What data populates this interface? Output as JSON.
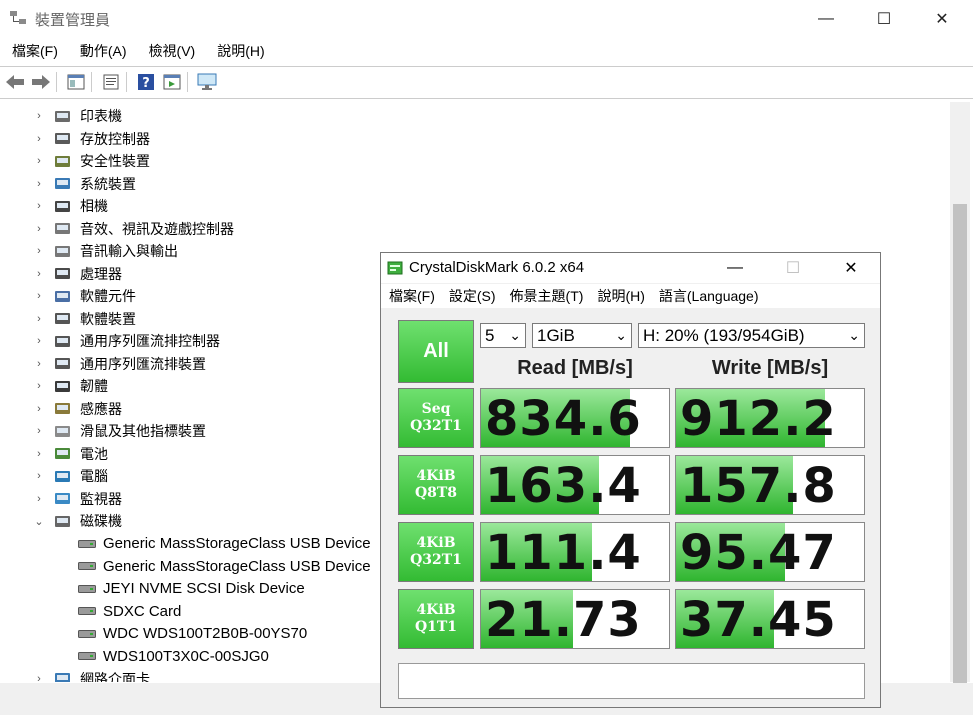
{
  "devmgr": {
    "title": "裝置管理員",
    "window_controls": {
      "minimize": "—",
      "maximize": "☐",
      "close": "✕"
    },
    "menu": [
      "檔案(F)",
      "動作(A)",
      "檢視(V)",
      "說明(H)"
    ],
    "toolbar_icons": [
      "back-arrow-icon",
      "forward-arrow-icon",
      "properties-icon",
      "update-driver-icon",
      "help-icon",
      "view-icon",
      "monitor-icon"
    ],
    "categories": [
      {
        "label": "印表機",
        "icon": "printer-icon",
        "expanded": false
      },
      {
        "label": "存放控制器",
        "icon": "storage-controller-icon",
        "expanded": false
      },
      {
        "label": "安全性裝置",
        "icon": "security-device-icon",
        "expanded": false
      },
      {
        "label": "系統裝置",
        "icon": "system-device-icon",
        "expanded": false
      },
      {
        "label": "相機",
        "icon": "camera-icon",
        "expanded": false
      },
      {
        "label": "音效、視訊及遊戲控制器",
        "icon": "speaker-icon",
        "expanded": false
      },
      {
        "label": "音訊輸入與輸出",
        "icon": "audio-io-icon",
        "expanded": false
      },
      {
        "label": "處理器",
        "icon": "processor-icon",
        "expanded": false
      },
      {
        "label": "軟體元件",
        "icon": "software-component-icon",
        "expanded": false
      },
      {
        "label": "軟體裝置",
        "icon": "software-device-icon",
        "expanded": false
      },
      {
        "label": "通用序列匯流排控制器",
        "icon": "usb-controller-icon",
        "expanded": false
      },
      {
        "label": "通用序列匯流排裝置",
        "icon": "usb-device-icon",
        "expanded": false
      },
      {
        "label": "韌體",
        "icon": "firmware-icon",
        "expanded": false
      },
      {
        "label": "感應器",
        "icon": "sensor-icon",
        "expanded": false
      },
      {
        "label": "滑鼠及其他指標裝置",
        "icon": "mouse-icon",
        "expanded": false
      },
      {
        "label": "電池",
        "icon": "battery-icon",
        "expanded": false
      },
      {
        "label": "電腦",
        "icon": "computer-icon",
        "expanded": false
      },
      {
        "label": "監視器",
        "icon": "monitor-icon",
        "expanded": false
      },
      {
        "label": "磁碟機",
        "icon": "disk-drive-icon",
        "expanded": true
      }
    ],
    "disk_drives": [
      "Generic MassStorageClass USB Device",
      "Generic MassStorageClass USB Device",
      "JEYI NVME SCSI Disk Device",
      "SDXC Card",
      "WDC  WDS100T2B0B-00YS70",
      "WDS100T3X0C-00SJG0"
    ],
    "last_category": {
      "label": "網路介面卡",
      "icon": "network-adapter-icon"
    }
  },
  "cdm": {
    "title": "CrystalDiskMark 6.0.2 x64",
    "window_controls": {
      "minimize": "—",
      "maximize": "☐",
      "close": "✕"
    },
    "menu": [
      "檔案(F)",
      "設定(S)",
      "佈景主題(T)",
      "說明(H)",
      "語言(Language)"
    ],
    "all_label": "All",
    "count_select": "5",
    "size_select": "1GiB",
    "drive_select": "H: 20% (193/954GiB)",
    "read_header": "Read [MB/s]",
    "write_header": "Write [MB/s]",
    "accent": "#33bb33",
    "tests": [
      {
        "line1": "Seq",
        "line2": "Q32T1",
        "read": "834.6",
        "write": "912.2",
        "read_fill": 0.79,
        "write_fill": 0.79
      },
      {
        "line1": "4KiB",
        "line2": "Q8T8",
        "read": "163.4",
        "write": "157.8",
        "read_fill": 0.63,
        "write_fill": 0.62
      },
      {
        "line1": "4KiB",
        "line2": "Q32T1",
        "read": "111.4",
        "write": "95.47",
        "read_fill": 0.59,
        "write_fill": 0.58
      },
      {
        "line1": "4KiB",
        "line2": "Q1T1",
        "read": "21.73",
        "write": "37.45",
        "read_fill": 0.49,
        "write_fill": 0.52
      }
    ]
  }
}
